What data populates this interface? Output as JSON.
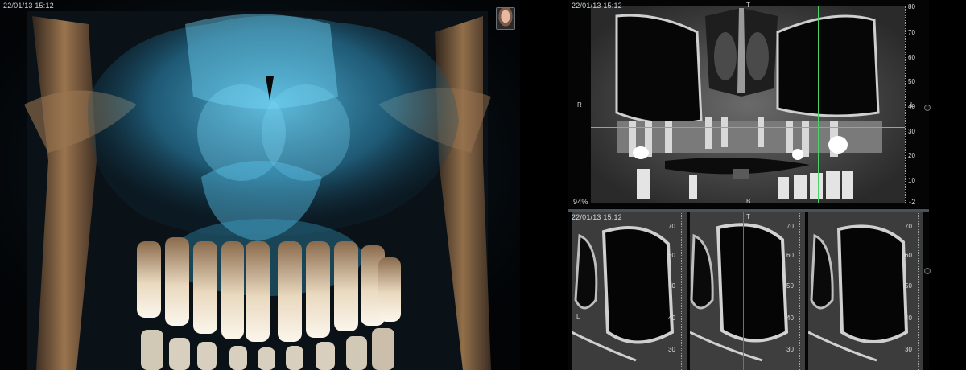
{
  "viewer": {
    "render3d": {
      "timestamp": "22/01/13 15:12"
    },
    "coronal": {
      "timestamp": "22/01/13 15:12",
      "zoom": "94%",
      "orientation_top": "T",
      "orientation_left": "R",
      "orientation_right": "L",
      "orientation_bottom": "B",
      "corner_value": "-2",
      "scale_ticks": [
        "80",
        "70",
        "60",
        "50",
        "40",
        "30",
        "20",
        "10"
      ]
    },
    "sagittal": {
      "timestamp": "22/01/13 15:12",
      "orientation_top": "T",
      "orientation_left": "L",
      "panels": [
        {
          "ticks": [
            "70",
            "60",
            "50",
            "40",
            "30"
          ]
        },
        {
          "ticks": [
            "70",
            "60",
            "50",
            "40",
            "30"
          ]
        },
        {
          "ticks": [
            "70",
            "60",
            "50",
            "40",
            "30"
          ]
        }
      ]
    }
  },
  "colors": {
    "crosshair_green": "#4ed16a",
    "crosshair_magenta": "#e0348a",
    "volume_cyan": "#3fb8e6",
    "bone_tan": "#c79a6a"
  }
}
